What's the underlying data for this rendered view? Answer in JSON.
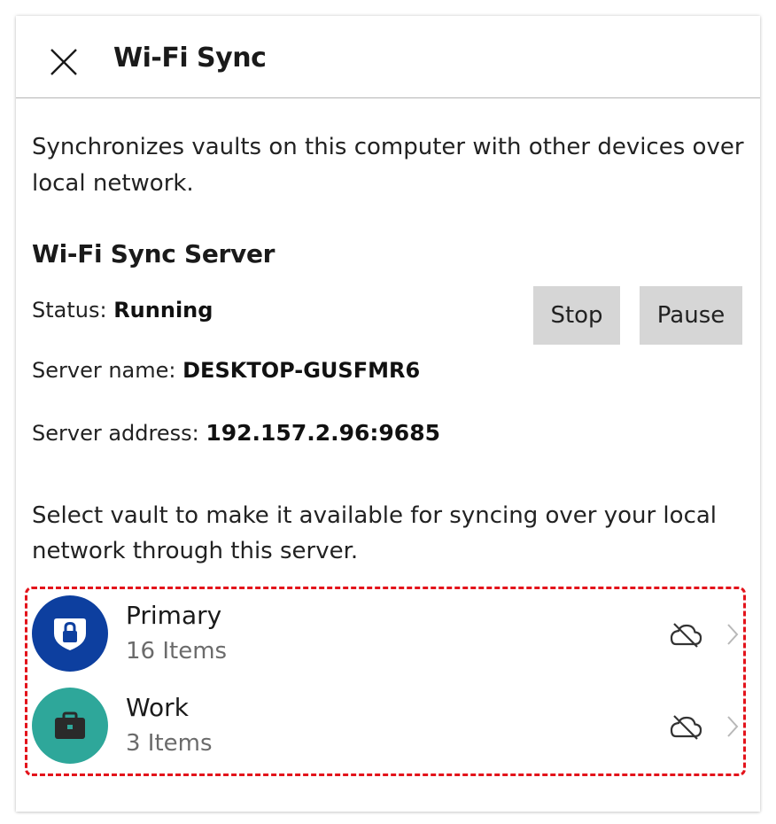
{
  "header": {
    "title": "Wi-Fi Sync",
    "close_icon": "close-icon"
  },
  "intro_text": "Synchronizes vaults on this computer with other devices over local network.",
  "server": {
    "section_title": "Wi-Fi Sync Server",
    "status_label": "Status:",
    "status_value": "Running",
    "name_label": "Server name:",
    "name_value": "DESKTOP-GUSFMR6",
    "address_label": "Server address:",
    "address_value": "192.157.2.96:9685",
    "stop_label": "Stop",
    "pause_label": "Pause"
  },
  "select_text": "Select vault to make it available for syncing over your local network through this server.",
  "vaults": [
    {
      "name": "Primary",
      "count": "16 Items",
      "icon": "lock-icon",
      "color": "#0d3f9f",
      "sync_icon": "cloud-off-icon"
    },
    {
      "name": "Work",
      "count": "3 Items",
      "icon": "briefcase-icon",
      "color": "#2ea79a",
      "sync_icon": "cloud-off-icon"
    }
  ],
  "colors": {
    "highlight_border": "#e3131b",
    "button_bg": "#d6d6d6"
  }
}
